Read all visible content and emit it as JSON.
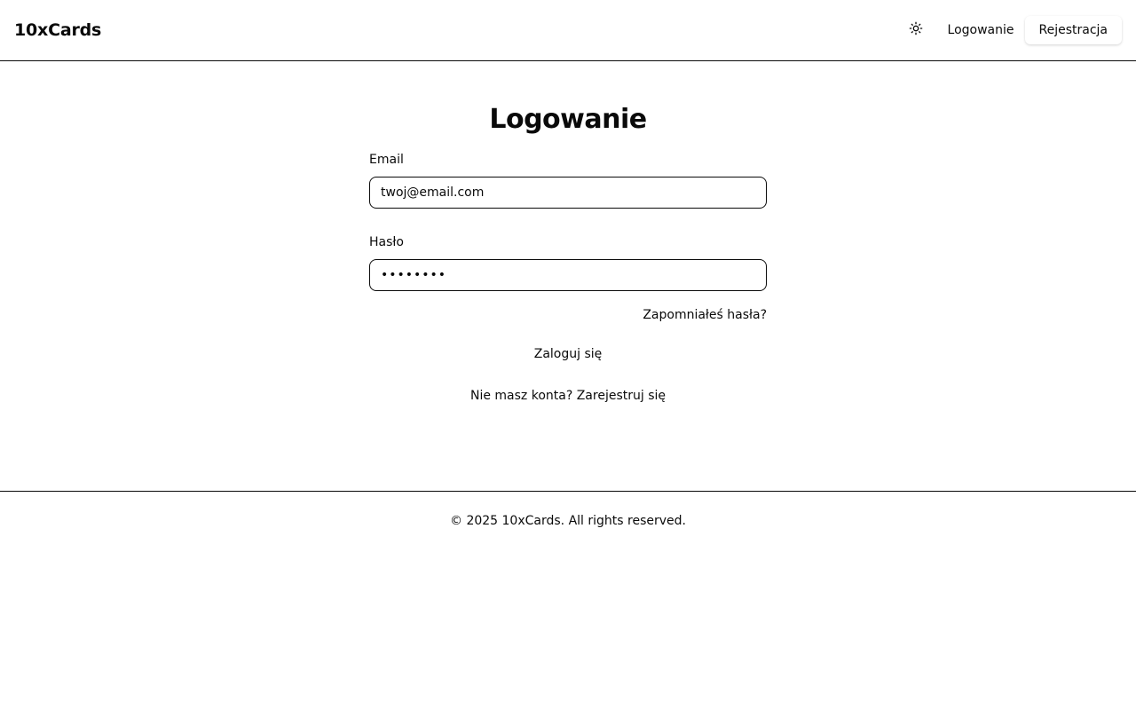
{
  "header": {
    "brand": "10xCards",
    "theme_icon": "sun-icon",
    "login_link": "Logowanie",
    "register_button": "Rejestracja"
  },
  "login_form": {
    "title": "Logowanie",
    "email_label": "Email",
    "email_value": "twoj@email.com",
    "password_label": "Hasło",
    "password_value": "••••••••",
    "forgot_link": "Zapomniałeś hasła?",
    "submit_label": "Zaloguj się",
    "register_prompt": "Nie masz konta?",
    "register_link": "Zarejestruj się"
  },
  "footer": {
    "copyright": "© 2025 10xCards. All rights reserved."
  },
  "colors": {
    "text": "#0a0a0a",
    "background": "#ffffff",
    "border": "#0a0a0a"
  }
}
